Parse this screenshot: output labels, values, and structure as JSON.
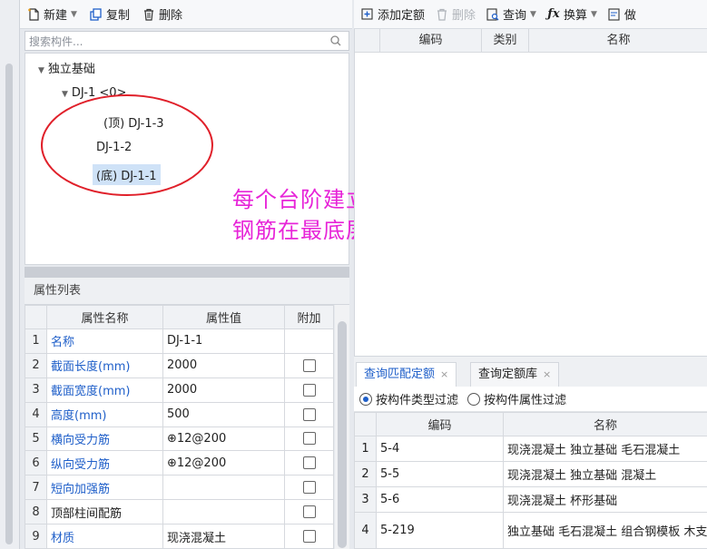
{
  "left_toolbar": {
    "new_label": "新建",
    "copy_label": "复制",
    "delete_label": "删除"
  },
  "search": {
    "placeholder": "搜索构件..."
  },
  "tree": {
    "root": "独立基础",
    "group": "DJ-1 <0>",
    "items": [
      "(顶) DJ-1-3",
      "DJ-1-2",
      "(底) DJ-1-1"
    ]
  },
  "annotation": {
    "line1": "每个台阶建立一个矩形单元",
    "line2": "钢筋在最底层单元输入信息。",
    "color": "#e724d8"
  },
  "properties": {
    "title": "属性列表",
    "headers": [
      "属性名称",
      "属性值",
      "附加"
    ],
    "rows": [
      {
        "num": "1",
        "name": "名称",
        "value": "DJ-1-1",
        "blue": true,
        "check": false
      },
      {
        "num": "2",
        "name": "截面长度(mm)",
        "value": "2000",
        "blue": true,
        "check": true
      },
      {
        "num": "3",
        "name": "截面宽度(mm)",
        "value": "2000",
        "blue": true,
        "check": true
      },
      {
        "num": "4",
        "name": "高度(mm)",
        "value": "500",
        "blue": true,
        "check": true
      },
      {
        "num": "5",
        "name": "横向受力筋",
        "value": "⊕12@200",
        "blue": true,
        "check": true
      },
      {
        "num": "6",
        "name": "纵向受力筋",
        "value": "⊕12@200",
        "blue": true,
        "check": true
      },
      {
        "num": "7",
        "name": "短向加强筋",
        "value": "",
        "blue": true,
        "check": true
      },
      {
        "num": "8",
        "name": "顶部柱间配筋",
        "value": "",
        "blue": false,
        "check": true
      },
      {
        "num": "9",
        "name": "材质",
        "value": "现浇混凝土",
        "blue": true,
        "check": true
      }
    ]
  },
  "right_toolbar": {
    "add_quota": "添加定额",
    "delete": "删除",
    "query": "查询",
    "convert": "换算",
    "do": "做"
  },
  "quota_table": {
    "headers": [
      "编码",
      "类别",
      "名称"
    ]
  },
  "bottom_tabs": [
    "查询匹配定额",
    "查询定额库"
  ],
  "filters": [
    "按构件类型过滤",
    "按构件属性过滤"
  ],
  "match_table": {
    "headers": [
      "编码",
      "名称"
    ],
    "rows": [
      {
        "num": "1",
        "code": "5-4",
        "name": "现浇混凝土 独立基础 毛石混凝土"
      },
      {
        "num": "2",
        "code": "5-5",
        "name": "现浇混凝土 独立基础 混凝土"
      },
      {
        "num": "3",
        "code": "5-6",
        "name": "现浇混凝土 杯形基础"
      },
      {
        "num": "4",
        "code": "5-219",
        "name": "独立基础 毛石混凝土 组合钢模板 木支撑"
      }
    ]
  },
  "colors": {
    "accent": "#1f5fc9",
    "ellipse": "#e0202a",
    "selection": "#cfe2f7"
  }
}
